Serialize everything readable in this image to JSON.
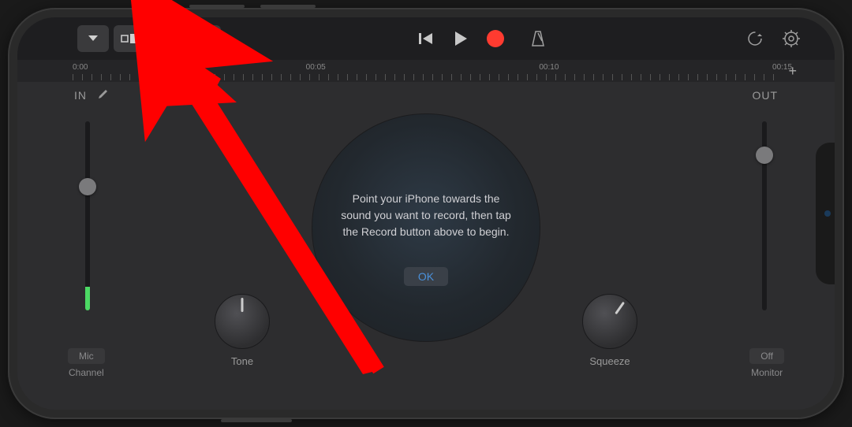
{
  "timeline": {
    "labels": [
      {
        "text": "0:00",
        "pos": 0
      },
      {
        "text": "00:05",
        "pos": 33
      },
      {
        "text": "00:10",
        "pos": 66
      },
      {
        "text": "00:15",
        "pos": 99
      }
    ]
  },
  "io": {
    "in_label": "IN",
    "out_label": "OUT"
  },
  "hint": {
    "text": "Point your iPhone towards the sound you want to record, then tap the Record button above to begin.",
    "ok_label": "OK"
  },
  "knobs": {
    "tone": "Tone",
    "squeeze": "Squeeze"
  },
  "corners": {
    "mic_btn": "Mic",
    "channel": "Channel",
    "off_btn": "Off",
    "monitor": "Monitor"
  }
}
